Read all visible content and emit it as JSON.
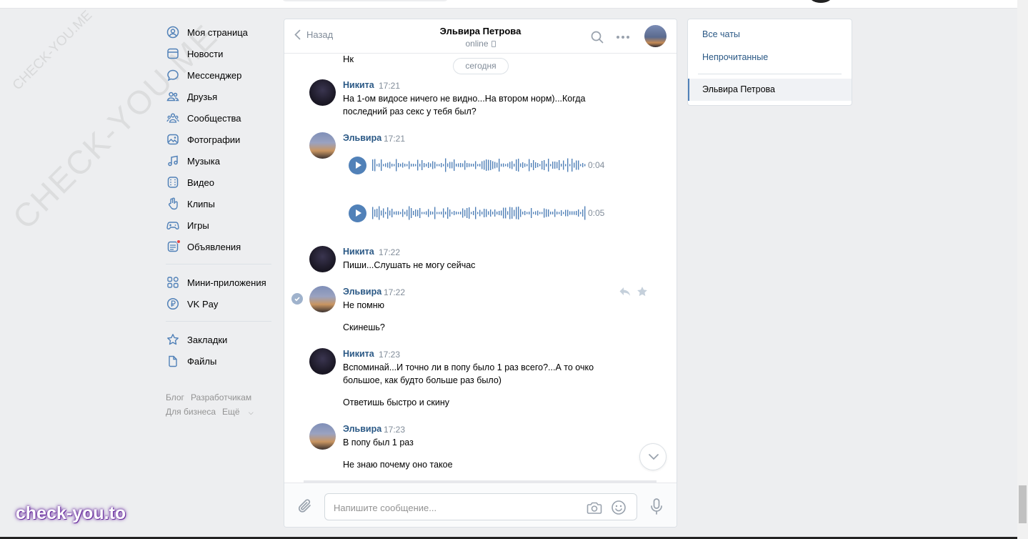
{
  "nav": {
    "items": [
      {
        "label": "Моя страница",
        "icon": "user-circle-icon"
      },
      {
        "label": "Новости",
        "icon": "news-icon"
      },
      {
        "label": "Мессенджер",
        "icon": "message-icon"
      },
      {
        "label": "Друзья",
        "icon": "friends-icon"
      },
      {
        "label": "Сообщества",
        "icon": "communities-icon"
      },
      {
        "label": "Фотографии",
        "icon": "photos-icon"
      },
      {
        "label": "Музыка",
        "icon": "music-icon"
      },
      {
        "label": "Видео",
        "icon": "video-icon"
      },
      {
        "label": "Клипы",
        "icon": "clips-icon"
      },
      {
        "label": "Игры",
        "icon": "games-icon"
      },
      {
        "label": "Объявления",
        "icon": "ads-icon"
      }
    ],
    "items2": [
      {
        "label": "Мини-приложения",
        "icon": "mini-apps-icon"
      },
      {
        "label": "VK Pay",
        "icon": "vkpay-icon"
      }
    ],
    "items3": [
      {
        "label": "Закладки",
        "icon": "bookmarks-icon"
      },
      {
        "label": "Файлы",
        "icon": "files-icon"
      }
    ],
    "footer": {
      "blog": "Блог",
      "devs": "Разработчикам",
      "business": "Для бизнеса",
      "more": "Ещё"
    }
  },
  "chat": {
    "back_label": "Назад",
    "peer_name": "Эльвира Петрова",
    "peer_status": "online",
    "date_divider": "сегодня",
    "prev_text": "Нк",
    "messages": [
      {
        "author": "Никита",
        "time": "17:21",
        "texts": [
          "На 1-ом видосе ничего не видно...На втором норм)...Когда последний раз секс у тебя был?"
        ]
      },
      {
        "author": "Эльвира",
        "time": "17:21",
        "voices": [
          {
            "duration": "0:04"
          },
          {
            "duration": "0:05"
          }
        ]
      },
      {
        "author": "Никита",
        "time": "17:22",
        "texts": [
          "Пиши...Слушать не могу сейчас"
        ]
      },
      {
        "author": "Эльвира",
        "time": "17:22",
        "texts": [
          "Не помню",
          "Скинешь?"
        ]
      },
      {
        "author": "Никита",
        "time": "17:23",
        "texts": [
          "Вспоминай...И точно ли в попу было 1 раз всего?...А то очко большое, как будто больше раз было)",
          "Ответишь быстро и скину"
        ]
      },
      {
        "author": "Эльвира",
        "time": "17:23",
        "texts": [
          "В попу был 1 раз",
          "Не знаю почему оно такое"
        ]
      }
    ],
    "composer_placeholder": "Напишите сообщение..."
  },
  "right": {
    "all_chats": "Все чаты",
    "unread": "Непрочитанные",
    "active_chat": "Эльвира Петрова"
  },
  "watermarks": {
    "diag": "CHECK-YOU.ME",
    "brand": "check-you.to"
  },
  "colors": {
    "link": "#2a5885",
    "accent": "#5181b8",
    "bg": "#edeef0"
  }
}
